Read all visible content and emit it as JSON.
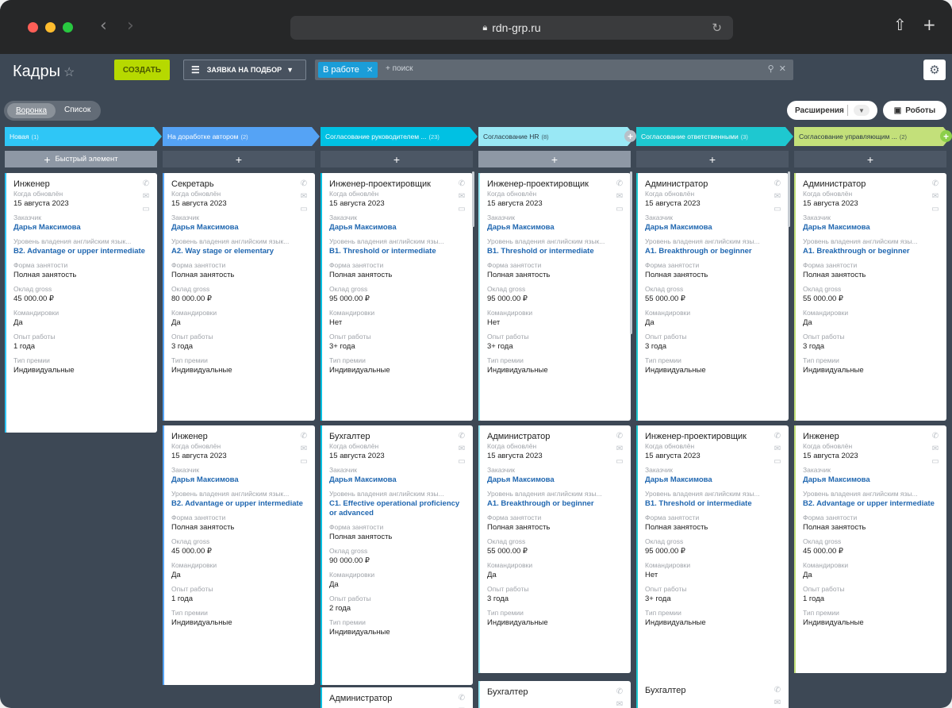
{
  "browser": {
    "url": "rdn-grp.ru",
    "colors": {
      "close": "#ff5f57",
      "minimize": "#febc2e",
      "zoom": "#28c840"
    }
  },
  "header": {
    "title": "Кадры",
    "create_label": "СОЗДАТЬ",
    "filter_label": "ЗАЯВКА НА ПОДБОР",
    "chip_label": "В работе",
    "search_placeholder": "+ поиск"
  },
  "view": {
    "funnel_label": "Воронка",
    "list_label": "Список",
    "extensions_label": "Расширения",
    "robots_label": "Роботы"
  },
  "quick_add_label": "Быстрый элемент",
  "labels": {
    "updated": "Когда обновлён",
    "customer": "Заказчик",
    "english": "Уровень владения английским язык...",
    "english_cut": "Уровень владения английским язы...",
    "employment": "Форма занятости",
    "salary": "Оклад gross",
    "trips": "Командировки",
    "experience": "Опыт работы",
    "bonus": "Тип премии"
  },
  "stages": [
    {
      "name": "Новая",
      "count": "(1)",
      "color": "#2fc6f6"
    },
    {
      "name": "На доработке автором",
      "count": "(2)",
      "color": "#55a3f5"
    },
    {
      "name": "Согласование руководителем ...",
      "count": "(23)",
      "color": "#00c1e3"
    },
    {
      "name": "Согласование HR",
      "count": "(8)",
      "color": "#99e8f5"
    },
    {
      "name": "Согласование ответственными",
      "count": "(3)",
      "color": "#1ec8d0"
    },
    {
      "name": "Согласование управляющим ...",
      "count": "(2)",
      "color": "#c3e07a"
    }
  ],
  "columns": [
    {
      "cards": [
        {
          "title": "Инженер",
          "date": "15 августа 2023",
          "customer": "Дарья Максимова",
          "english": "B2. Advantage or upper intermediate",
          "employment": "Полная занятость",
          "salary": "45 000.00 ₽",
          "trips": "Да",
          "experience": "1 года",
          "bonus": "Индивидуальные"
        }
      ]
    },
    {
      "cards": [
        {
          "title": "Секретарь",
          "date": "15 августа 2023",
          "customer": "Дарья Максимова",
          "english": "A2. Way stage or elementary",
          "employment": "Полная занятость",
          "salary": "80 000.00 ₽",
          "trips": "Да",
          "experience": "3 года",
          "bonus": "Индивидуальные"
        },
        {
          "title": "Инженер",
          "date": "15 августа 2023",
          "customer": "Дарья Максимова",
          "english": "B2. Advantage or upper intermediate",
          "employment": "Полная занятость",
          "salary": "45 000.00 ₽",
          "trips": "Да",
          "experience": "1 года",
          "bonus": "Индивидуальные"
        }
      ]
    },
    {
      "cards": [
        {
          "title": "Инженер-проектировщик",
          "date": "15 августа 2023",
          "customer": "Дарья Максимова",
          "english": "B1. Threshold or intermediate",
          "employment": "Полная занятость",
          "salary": "95 000.00 ₽",
          "trips": "Нет",
          "experience": "3+ года",
          "bonus": "Индивидуальные"
        },
        {
          "title": "Бухгалтер",
          "date": "15 августа 2023",
          "customer": "Дарья Максимова",
          "english": "C1. Effective operational proficiency or advanced",
          "employment": "Полная занятость",
          "salary": "90 000.00 ₽",
          "trips": "Да",
          "experience": "2 года",
          "bonus": "Индивидуальные"
        },
        {
          "title": "Администратор"
        }
      ]
    },
    {
      "cards": [
        {
          "title": "Инженер-проектировщик",
          "date": "15 августа 2023",
          "customer": "Дарья Максимова",
          "english": "B1. Threshold or intermediate",
          "employment": "Полная занятость",
          "salary": "95 000.00 ₽",
          "trips": "Нет",
          "experience": "3+ года",
          "bonus": "Индивидуальные"
        },
        {
          "title": "Администратор",
          "date": "15 августа 2023",
          "customer": "Дарья Максимова",
          "english": "A1. Breakthrough or beginner",
          "employment": "Полная занятость",
          "salary": "55 000.00 ₽",
          "trips": "Да",
          "experience": "3 года",
          "bonus": "Индивидуальные"
        },
        {
          "title": "Бухгалтер"
        }
      ]
    },
    {
      "cards": [
        {
          "title": "Администратор",
          "date": "15 августа 2023",
          "customer": "Дарья Максимова",
          "english": "A1. Breakthrough or beginner",
          "employment": "Полная занятость",
          "salary": "55 000.00 ₽",
          "trips": "Да",
          "experience": "3 года",
          "bonus": "Индивидуальные"
        },
        {
          "title": "Инженер-проектировщик",
          "date": "15 августа 2023",
          "customer": "Дарья Максимова",
          "english": "B1. Threshold or intermediate",
          "employment": "Полная занятость",
          "salary": "95 000.00 ₽",
          "trips": "Нет",
          "experience": "3+ года",
          "bonus": "Индивидуальные"
        },
        {
          "title": "Бухгалтер"
        }
      ]
    },
    {
      "cards": [
        {
          "title": "Администратор",
          "date": "15 августа 2023",
          "customer": "Дарья Максимова",
          "english": "A1. Breakthrough or beginner",
          "employment": "Полная занятость",
          "salary": "55 000.00 ₽",
          "trips": "Да",
          "experience": "3 года",
          "bonus": "Индивидуальные"
        },
        {
          "title": "Инженер",
          "date": "15 августа 2023",
          "customer": "Дарья Максимова",
          "english": "B2. Advantage or upper intermediate",
          "employment": "Полная занятость",
          "salary": "45 000.00 ₽",
          "trips": "Да",
          "experience": "1 года",
          "bonus": "Индивидуальные"
        }
      ]
    }
  ]
}
